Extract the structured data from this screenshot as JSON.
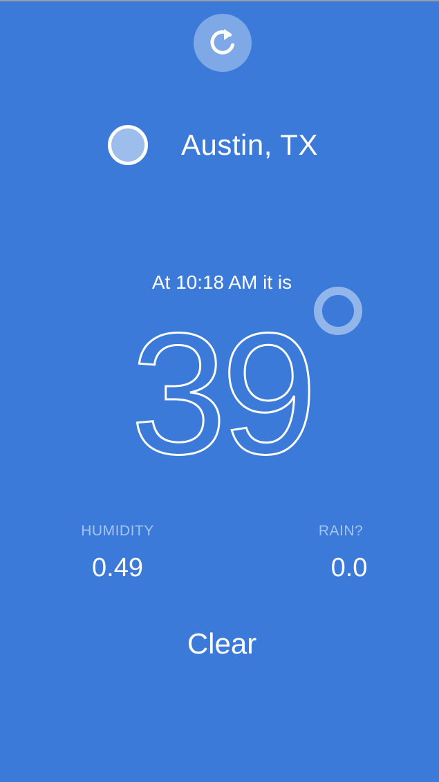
{
  "icons": {
    "refresh": "refresh-icon",
    "location": "location-dot-icon",
    "degree": "degree-icon"
  },
  "colors": {
    "background": "#3b7ad9",
    "foreground": "#ffffff"
  },
  "location": {
    "name": "Austin, TX"
  },
  "weather": {
    "time_label": "At 10:18 AM it is",
    "temperature": "39",
    "condition": "Clear"
  },
  "stats": {
    "humidity": {
      "label": "HUMIDITY",
      "value": "0.49"
    },
    "rain": {
      "label": "RAIN?",
      "value": "0.0"
    }
  }
}
